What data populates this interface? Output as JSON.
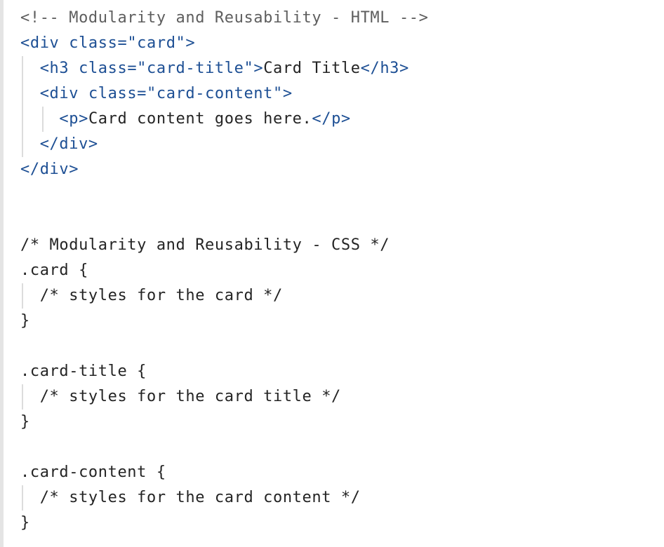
{
  "code_lines": [
    {
      "segments": [
        {
          "text": "<!-- Modularity and Reusability - HTML -->",
          "cls": "c"
        }
      ]
    },
    {
      "segments": [
        {
          "text": "<div ",
          "cls": "t"
        },
        {
          "text": "class=",
          "cls": "t"
        },
        {
          "text": "\"card\"",
          "cls": "s"
        },
        {
          "text": ">",
          "cls": "t"
        }
      ]
    },
    {
      "segments": [
        {
          "text": "  "
        },
        {
          "text": "<h3 ",
          "cls": "t"
        },
        {
          "text": "class=",
          "cls": "t"
        },
        {
          "text": "\"card-title\"",
          "cls": "s"
        },
        {
          "text": ">",
          "cls": "t"
        },
        {
          "text": "Card Title",
          "cls": "p"
        },
        {
          "text": "</h3>",
          "cls": "t"
        }
      ]
    },
    {
      "segments": [
        {
          "text": "  "
        },
        {
          "text": "<div ",
          "cls": "t"
        },
        {
          "text": "class=",
          "cls": "t"
        },
        {
          "text": "\"card-content\"",
          "cls": "s"
        },
        {
          "text": ">",
          "cls": "t"
        }
      ]
    },
    {
      "segments": [
        {
          "text": "    "
        },
        {
          "text": "<p>",
          "cls": "t"
        },
        {
          "text": "Card content goes here.",
          "cls": "p"
        },
        {
          "text": "</p>",
          "cls": "t"
        }
      ]
    },
    {
      "segments": [
        {
          "text": "  "
        },
        {
          "text": "</div>",
          "cls": "t"
        }
      ]
    },
    {
      "segments": [
        {
          "text": "</div>",
          "cls": "t"
        }
      ]
    },
    {
      "segments": []
    },
    {
      "segments": []
    },
    {
      "segments": [
        {
          "text": "/* Modularity and Reusability - CSS */",
          "cls": "p"
        }
      ]
    },
    {
      "segments": [
        {
          "text": ".card {",
          "cls": "p"
        }
      ]
    },
    {
      "segments": [
        {
          "text": "  "
        },
        {
          "text": "/* styles for the card */",
          "cls": "p"
        }
      ]
    },
    {
      "segments": [
        {
          "text": "}",
          "cls": "p"
        }
      ]
    },
    {
      "segments": []
    },
    {
      "segments": [
        {
          "text": ".card-title {",
          "cls": "p"
        }
      ]
    },
    {
      "segments": [
        {
          "text": "  "
        },
        {
          "text": "/* styles for the card title */",
          "cls": "p"
        }
      ]
    },
    {
      "segments": [
        {
          "text": "}",
          "cls": "p"
        }
      ]
    },
    {
      "segments": []
    },
    {
      "segments": [
        {
          "text": ".card-content {",
          "cls": "p"
        }
      ]
    },
    {
      "segments": [
        {
          "text": "  "
        },
        {
          "text": "/* styles for the card content */",
          "cls": "p"
        }
      ]
    },
    {
      "segments": [
        {
          "text": "}",
          "cls": "p"
        }
      ]
    }
  ]
}
